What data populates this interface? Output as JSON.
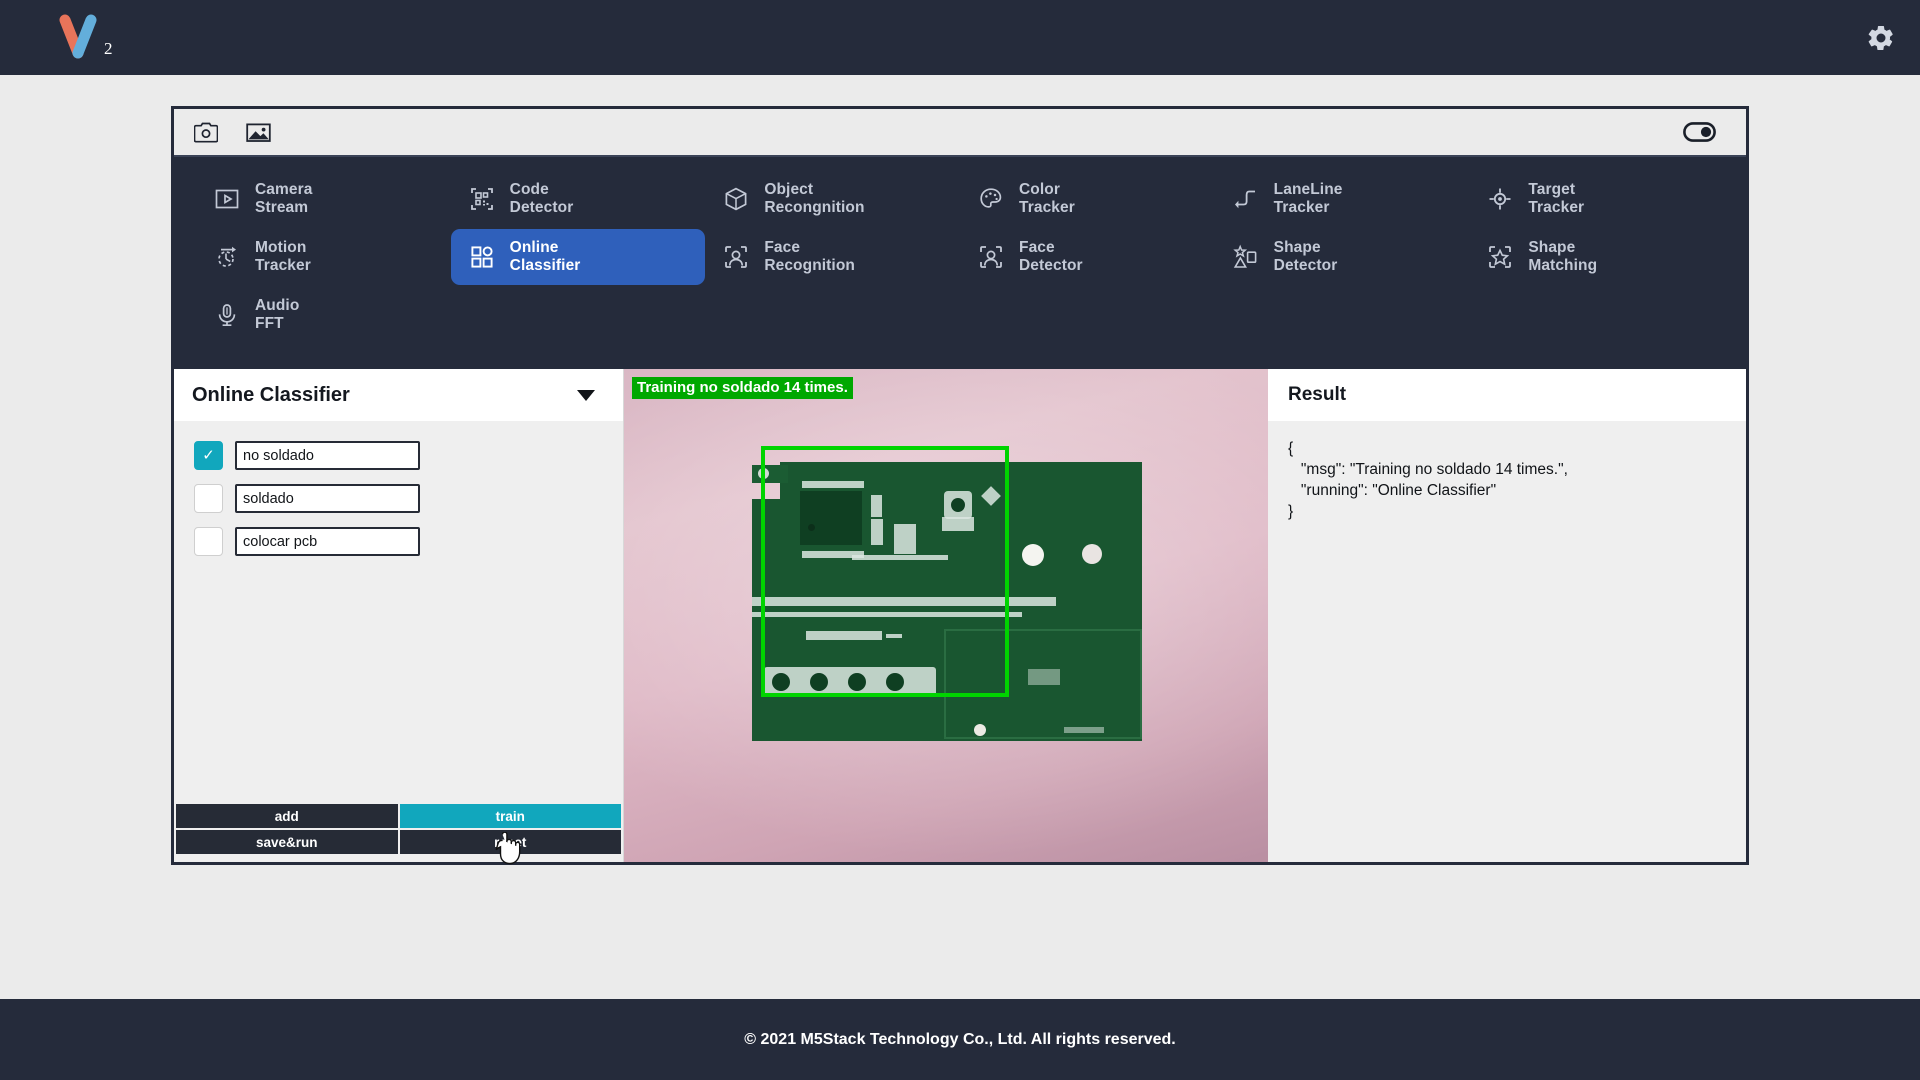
{
  "header": {
    "logo_subscript": "2",
    "logo_left_color": "#e8745a",
    "logo_right_color": "#63aedb",
    "gear_icon": "gear-icon",
    "bg": "#252b3b"
  },
  "toolbar": {
    "camera_icon": "camera-icon",
    "image_icon": "image-icon",
    "toggle_icon": "toggle-on-icon",
    "toggle_state": "on"
  },
  "functions": [
    {
      "icon": "camera-stream-icon",
      "line1": "Camera",
      "line2": "Stream",
      "active": false
    },
    {
      "icon": "qrcode-icon",
      "line1": "Code",
      "line2": "Detector",
      "active": false
    },
    {
      "icon": "cube-icon",
      "line1": "Object",
      "line2": "Recongnition",
      "active": false
    },
    {
      "icon": "palette-icon",
      "line1": "Color",
      "line2": "Tracker",
      "active": false
    },
    {
      "icon": "laneline-icon",
      "line1": "LaneLine",
      "line2": "Tracker",
      "active": false
    },
    {
      "icon": "crosshair-icon",
      "line1": "Target",
      "line2": "Tracker",
      "active": false
    },
    {
      "icon": "motion-icon",
      "line1": "Motion",
      "line2": "Tracker",
      "active": false
    },
    {
      "icon": "grid-squares-icon",
      "line1": "Online",
      "line2": "Classifier",
      "active": true
    },
    {
      "icon": "face-recognition-icon",
      "line1": "Face",
      "line2": "Recognition",
      "active": false
    },
    {
      "icon": "face-detect-icon",
      "line1": "Face",
      "line2": "Detector",
      "active": false
    },
    {
      "icon": "shape-detect-icon",
      "line1": "Shape",
      "line2": "Detector",
      "active": false
    },
    {
      "icon": "shape-match-icon",
      "line1": "Shape",
      "line2": "Matching",
      "active": false
    },
    {
      "icon": "microphone-icon",
      "line1": "Audio",
      "line2": "FFT",
      "active": false
    }
  ],
  "left_panel": {
    "title": "Online Classifier",
    "caret_icon": "chevron-down-icon",
    "classes": [
      {
        "label": "no soldado",
        "checked": true
      },
      {
        "label": "soldado",
        "checked": false
      },
      {
        "label": "colocar pcb",
        "checked": false
      }
    ],
    "buttons": [
      {
        "label": "add",
        "style": "dark"
      },
      {
        "label": "train",
        "style": "teal"
      },
      {
        "label": "save&run",
        "style": "dark"
      },
      {
        "label": "reset",
        "style": "dark"
      }
    ],
    "accent_teal": "#11a7bd"
  },
  "video": {
    "banner_text": "Training no soldado 14 times.",
    "banner_bg": "#00a800",
    "bbox_color": "#00d400",
    "subject": "green-pcb-circuit-board"
  },
  "right_panel": {
    "title": "Result",
    "result_json": "{\n   \"msg\": \"Training no soldado 14 times.\",\n   \"running\": \"Online Classifier\"\n}"
  },
  "footer": {
    "text": "© 2021 M5Stack Technology Co., Ltd. All rights reserved."
  }
}
